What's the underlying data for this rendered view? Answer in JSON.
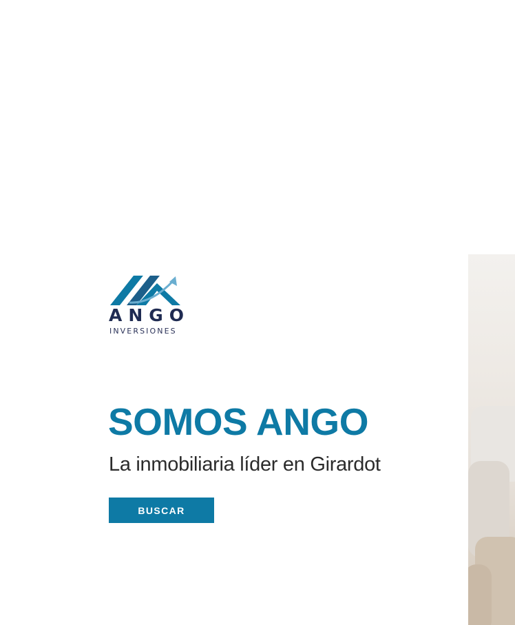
{
  "brand": {
    "name": "ANGO",
    "tagline": "INVERSIONES",
    "colors": {
      "primary": "#0e7aa5",
      "dark": "#1f2b52",
      "arrow": "#6aaed0"
    }
  },
  "hero": {
    "title": "SOMOS ANGO",
    "subtitle": "La inmobiliaria líder en Girardot",
    "cta_label": "BUSCAR"
  },
  "icons": {
    "logo_mark": "house-roof-arrow-icon"
  }
}
